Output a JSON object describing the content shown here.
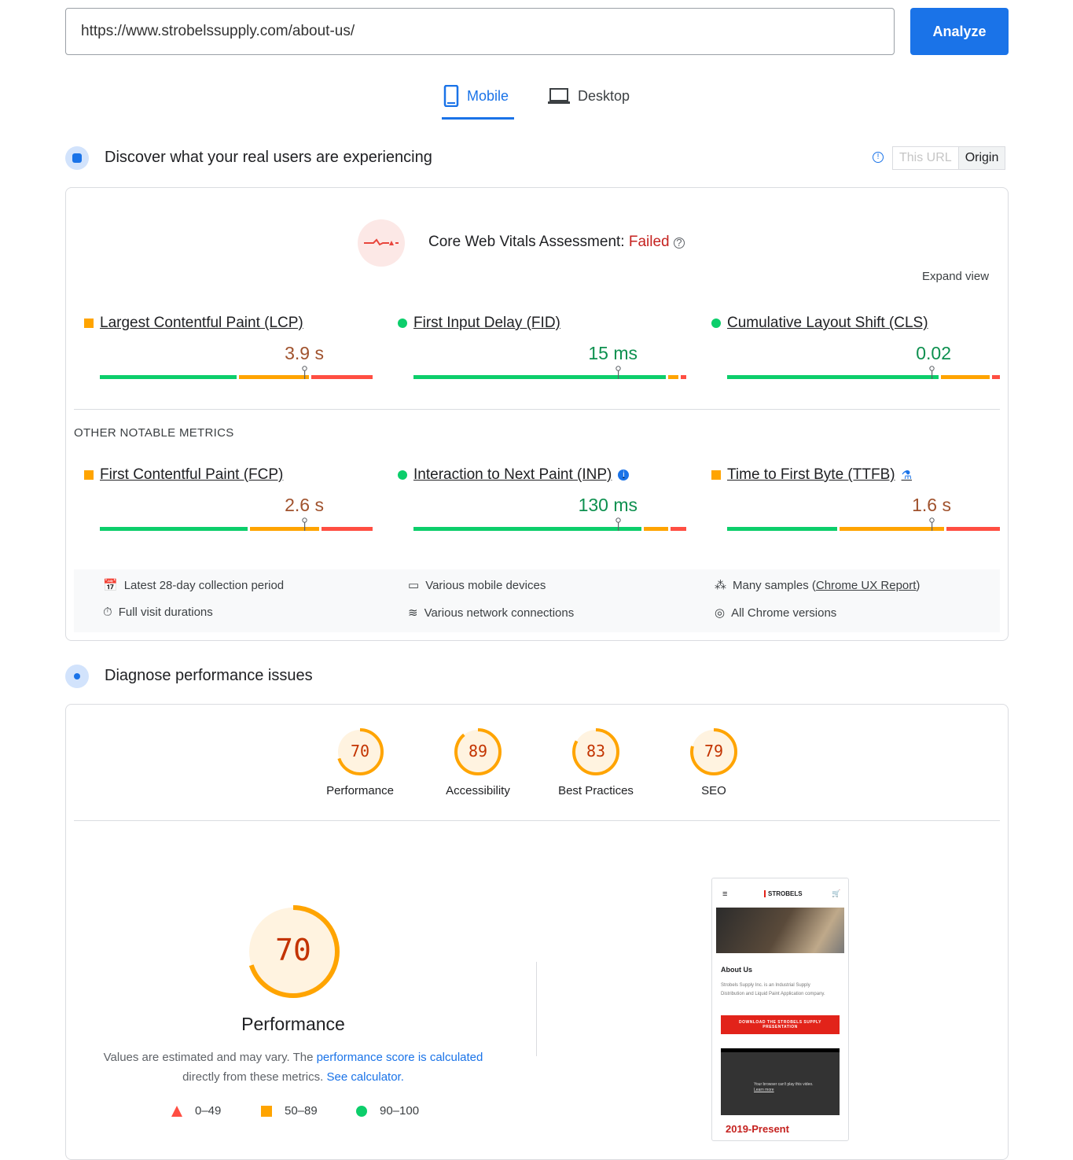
{
  "url_input": {
    "value": "https://www.strobelssupply.com/about-us/"
  },
  "analyze_label": "Analyze",
  "tabs": [
    {
      "label": "Mobile",
      "active": true
    },
    {
      "label": "Desktop",
      "active": false
    }
  ],
  "field": {
    "title": "Discover what your real users are experiencing",
    "toggle": [
      "This URL",
      "Origin"
    ],
    "assessment_label": "Core Web Vitals Assessment: ",
    "assessment_status": "Failed",
    "expand": "Expand view",
    "other_heading": "OTHER NOTABLE METRICS",
    "metrics": [
      {
        "name": "Largest Contentful Paint (LCP)",
        "value": "3.9 s",
        "rating": "needs-improvement",
        "dist": [
          51,
          26,
          23
        ]
      },
      {
        "name": "First Input Delay (FID)",
        "value": "15 ms",
        "rating": "good",
        "dist": [
          94,
          4,
          2
        ]
      },
      {
        "name": "Cumulative Layout Shift (CLS)",
        "value": "0.02",
        "rating": "good",
        "dist": [
          79,
          18,
          3
        ]
      },
      {
        "name": "First Contentful Paint (FCP)",
        "value": "2.6 s",
        "rating": "needs-improvement",
        "dist": [
          55,
          26,
          19
        ]
      },
      {
        "name": "Interaction to Next Paint (INP)",
        "value": "130 ms",
        "rating": "good",
        "dist": [
          85,
          9,
          6
        ]
      },
      {
        "name": "Time to First Byte (TTFB)",
        "value": "1.6 s",
        "rating": "needs-improvement",
        "dist": [
          41,
          39,
          20
        ]
      }
    ],
    "info": [
      "Latest 28-day collection period",
      "Various mobile devices",
      "Many samples (",
      "Chrome UX Report",
      ")",
      "Full visit durations",
      "Various network connections",
      "All Chrome versions"
    ]
  },
  "lab": {
    "title": "Diagnose performance issues",
    "scores": [
      {
        "label": "Performance",
        "value": "70",
        "score": 70
      },
      {
        "label": "Accessibility",
        "value": "89",
        "score": 89
      },
      {
        "label": "Best Practices",
        "value": "83",
        "score": 83
      },
      {
        "label": "SEO",
        "value": "79",
        "score": 79
      }
    ],
    "big_score": "70",
    "big_label": "Performance",
    "desc1": "Values are estimated and may vary. The ",
    "desc_link1": "performance score is calculated",
    "desc2": "directly from these metrics. ",
    "desc_link2": "See calculator.",
    "legend": [
      "0–49",
      "50–89",
      "90–100"
    ],
    "screenshot": {
      "logo": "STROBELS",
      "heading": "About Us",
      "text": "Strobels Supply Inc. is an Industrial Supply Distribution and Liquid Paint Application company.",
      "button": "DOWNLOAD THE STROBELS SUPPLY PRESENTATION",
      "video_msg": "Your browser can't play this video.",
      "video_link": "Learn more",
      "footer": "2019-Present"
    }
  },
  "colors": {
    "accent": "#1a73e8",
    "good": "#0cce6b",
    "average": "#ffa400",
    "poor": "#ff4e42",
    "failed": "#c5221f"
  }
}
